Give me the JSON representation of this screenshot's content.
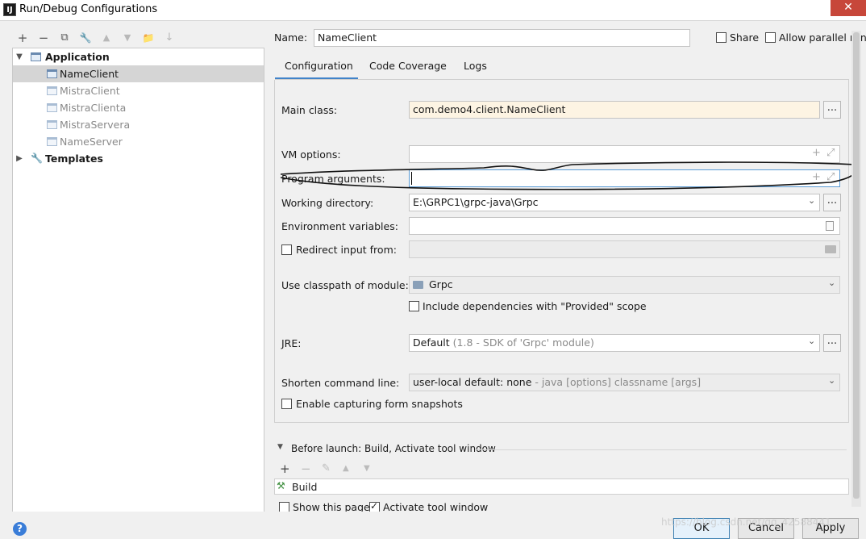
{
  "window": {
    "title": "Run/Debug Configurations",
    "app_icon": "IJ",
    "close_glyph": "✕"
  },
  "toolbar": {
    "add": "+",
    "remove": "−",
    "copy": "⧉",
    "edit": "🔧",
    "up": "▲",
    "down": "▼",
    "folder": "📁",
    "sort": "↓"
  },
  "tree": {
    "group_label": "Application",
    "items": [
      "NameClient",
      "MistraClient",
      "MistraClienta",
      "MistraServera",
      "NameServer"
    ],
    "templates_label": "Templates"
  },
  "header": {
    "name_label": "Name:",
    "name_value": "NameClient",
    "share_label": "Share",
    "parallel_label": "Allow parallel run"
  },
  "tabs": [
    "Configuration",
    "Code Coverage",
    "Logs"
  ],
  "form": {
    "main_class_label": "Main class:",
    "main_class_value": "com.demo4.client.NameClient",
    "vm_label": "VM options:",
    "program_args_label": "Program arguments:",
    "workdir_label": "Working directory:",
    "workdir_value": "E:\\GRPC1\\grpc-java\\Grpc",
    "env_label": "Environment variables:",
    "redirect_label": "Redirect input from:",
    "classpath_label": "Use classpath of module:",
    "classpath_value": "Grpc",
    "include_deps_label": "Include dependencies with \"Provided\" scope",
    "jre_label": "JRE:",
    "jre_value": "Default",
    "jre_hint": "(1.8 - SDK of 'Grpc' module)",
    "shorten_label": "Shorten command line:",
    "shorten_value": "user-local default: none",
    "shorten_hint": "- java [options] classname [args]",
    "snapshots_label": "Enable capturing form snapshots",
    "dots": "...",
    "plus_icon": "+",
    "expand_icon": "⤢",
    "combo_arrow": "⌄"
  },
  "before_launch": {
    "header": "Before launch: Build, Activate tool window",
    "toolbar_add": "+",
    "toolbar_remove": "−",
    "toolbar_edit": "✎",
    "toolbar_up": "▲",
    "toolbar_down": "▼",
    "item": "Build",
    "show_page_label": "Show this page",
    "activate_label": "Activate tool window"
  },
  "footer": {
    "ok": "OK",
    "cancel": "Cancel",
    "apply": "Apply",
    "help": "?",
    "watermark": "https://blog.csdn.net/qq_42588441"
  },
  "colors": {
    "accent": "#4083c9",
    "selection": "#d5d5d5",
    "highlight_field": "#fdf4e3"
  }
}
